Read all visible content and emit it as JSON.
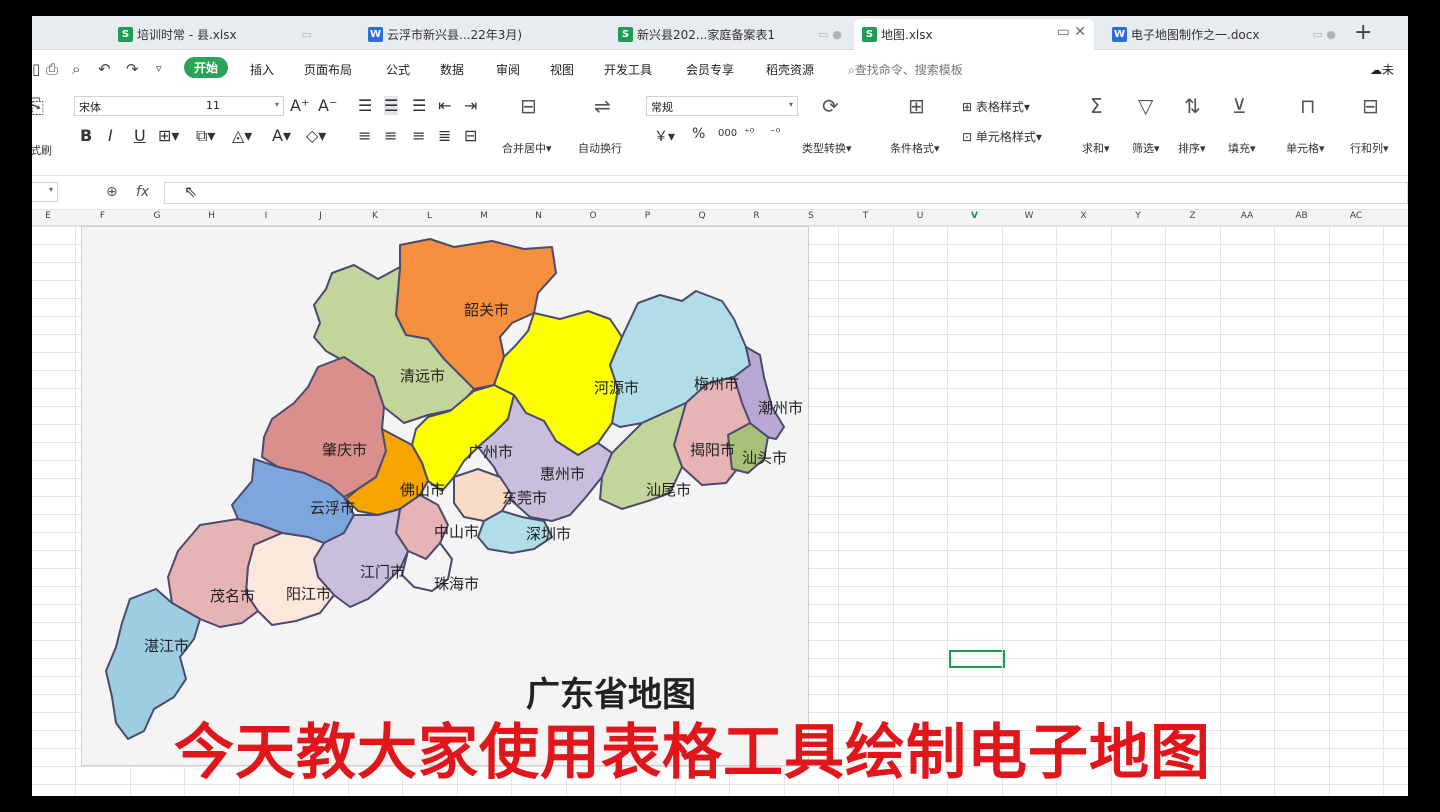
{
  "tabs": [
    {
      "icon": "S",
      "label": "培训时常 - 县.xlsx"
    },
    {
      "icon": "W",
      "label": "云浮市新兴县...22年3月)"
    },
    {
      "icon": "S",
      "label": "新兴县202...家庭备案表1"
    },
    {
      "icon": "S",
      "label": "地图.xlsx",
      "active": true
    },
    {
      "icon": "W",
      "label": "电子地图制作之一.docx"
    }
  ],
  "menu": {
    "items": [
      "开始",
      "插入",
      "页面布局",
      "公式",
      "数据",
      "审阅",
      "视图",
      "开发工具",
      "会员专享",
      "稻壳资源"
    ],
    "search_placeholder": "查找命令、搜索模板",
    "right_partial": "未"
  },
  "ribbon": {
    "format_painter": "式刷",
    "font_name": "宋体",
    "font_size": "11",
    "merge_center": "合并居中",
    "wrap_text": "自动换行",
    "number_format": "常规",
    "type_convert": "类型转换",
    "cond_format": "条件格式",
    "table_style": "表格样式",
    "cell_style": "单元格样式",
    "sum": "求和",
    "filter": "筛选",
    "sort": "排序",
    "fill": "填充",
    "cell": "单元格",
    "row_col": "行和列",
    "currency": "￥",
    "percent": "%",
    "thousands": "000"
  },
  "formula_bar": {
    "fx": "fx"
  },
  "columns": [
    "E",
    "F",
    "G",
    "H",
    "I",
    "J",
    "K",
    "L",
    "M",
    "N",
    "O",
    "P",
    "Q",
    "R",
    "S",
    "T",
    "U",
    "V",
    "W",
    "X",
    "Y",
    "Z",
    "AA",
    "AB",
    "AC"
  ],
  "selected_column": "V",
  "map": {
    "title": "广东省地图",
    "cities": [
      {
        "name": "韶关市",
        "color": "#f5903e"
      },
      {
        "name": "清远市",
        "color": "#c3d59b"
      },
      {
        "name": "河源市",
        "color": "#fcff00"
      },
      {
        "name": "梅州市",
        "color": "#b1dde8"
      },
      {
        "name": "潮州市",
        "color": "#b9a8d4"
      },
      {
        "name": "肇庆市",
        "color": "#d98f8c"
      },
      {
        "name": "广州市",
        "color": "#fcff00"
      },
      {
        "name": "揭阳市",
        "color": "#e6b4b4"
      },
      {
        "name": "汕头市",
        "color": "#a7c07a"
      },
      {
        "name": "惠州市",
        "color": "#c9bfdd"
      },
      {
        "name": "佛山市",
        "color": "#f6a500"
      },
      {
        "name": "东莞市",
        "color": "#f8dcc6"
      },
      {
        "name": "汕尾市",
        "color": "#c3d59b"
      },
      {
        "name": "云浮市",
        "color": "#7ca6dc"
      },
      {
        "name": "中山市",
        "color": "#e6b4b4"
      },
      {
        "name": "深圳市",
        "color": "#b1dde8"
      },
      {
        "name": "江门市",
        "color": "#c9bfdd"
      },
      {
        "name": "茂名市",
        "color": "#e6b4b4"
      },
      {
        "name": "阳江市",
        "color": "#fbe7dc"
      },
      {
        "name": "珠海市",
        "color": "#f4f4f4"
      },
      {
        "name": "湛江市",
        "color": "#9dcde0"
      }
    ]
  },
  "caption": "今天教大家使用表格工具绘制电子地图"
}
